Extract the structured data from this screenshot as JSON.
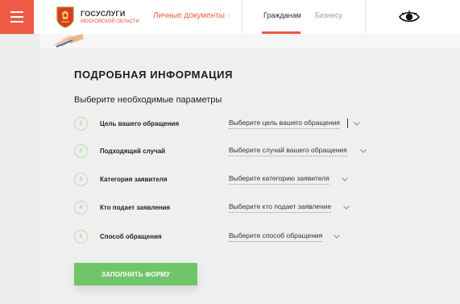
{
  "header": {
    "logo_title": "ГОСУСЛУГИ",
    "logo_subtitle": "МОСКОВСКОЙ ОБЛАСТИ",
    "docs_link": "Личные документы",
    "tabs": [
      {
        "label": "Гражданам",
        "active": true
      },
      {
        "label": "Бизнесу",
        "active": false
      }
    ],
    "accent_color": "#ef5a44",
    "icons": {
      "menu": "hamburger-icon",
      "accessibility": "eye-icon",
      "chevron": "chevron-right-icon"
    }
  },
  "form": {
    "title": "ПОДРОБНАЯ ИНФОРМАЦИЯ",
    "subtitle": "Выберите необходимые параметры",
    "fields": [
      {
        "number": "1",
        "label": "Цель вашего обращения",
        "placeholder": "Выберите цель вашего обращения"
      },
      {
        "number": "2",
        "label": "Подходящий случай",
        "placeholder": "Выберите случай вашего обращения"
      },
      {
        "number": "3",
        "label": "Категория заявителя",
        "placeholder": "Выберите категорию заявителя"
      },
      {
        "number": "4",
        "label": "Кто подает заявления",
        "placeholder": "Выберите кто подает заявление"
      },
      {
        "number": "5",
        "label": "Способ обращения",
        "placeholder": "Выберите способ обращения"
      }
    ],
    "submit_label": "ЗАПОЛНИТЬ ФОРМУ",
    "submit_color": "#70c56a"
  }
}
